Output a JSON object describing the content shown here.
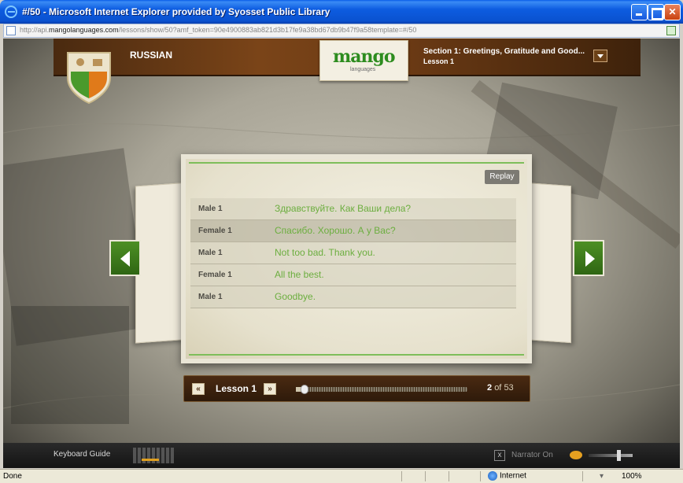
{
  "window": {
    "title": "#/50 - Microsoft Internet Explorer provided by Syosset Public Library",
    "url_prefix": "http://api.",
    "url_host": "mangolanguages.com",
    "url_rest": "/lessons/show/50?amf_token=90e4900883ab821d3b17fe9a38bd67db9b47f9a58template=#/50"
  },
  "header": {
    "language": "RUSSIAN",
    "logo_text": "mango",
    "logo_sub": "languages",
    "section": "Section 1: Greetings, Gratitude and Good...",
    "lesson": "Lesson 1"
  },
  "card": {
    "replay_label": "Replay",
    "rows": [
      {
        "speaker": "Male 1",
        "text": "Здравствуйте. Как Ваши дела?"
      },
      {
        "speaker": "Female 1",
        "text": "Спасибо. Хорошо. А у Вас?"
      },
      {
        "speaker": "Male 1",
        "text": "Not too bad. Thank you."
      },
      {
        "speaker": "Female 1",
        "text": "All the best."
      },
      {
        "speaker": "Male 1",
        "text": "Goodbye."
      }
    ],
    "selected_row": 1
  },
  "scrubber": {
    "prev_label": "«",
    "next_label": "»",
    "lesson_title": "Lesson 1",
    "current": "2",
    "of_label": "of",
    "total": "53",
    "progress_fraction": 0.038
  },
  "bottombar": {
    "keyboard_guide": "Keyboard Guide",
    "narrator_checkbox": "x",
    "narrator_label": "Narrator On"
  },
  "statusbar": {
    "status": "Done",
    "zone": "Internet",
    "zoom": "100%"
  },
  "colors": {
    "accent_green": "#6cae3f",
    "header_brown": "#6b3a14",
    "nav_green": "#3d7a1b"
  }
}
